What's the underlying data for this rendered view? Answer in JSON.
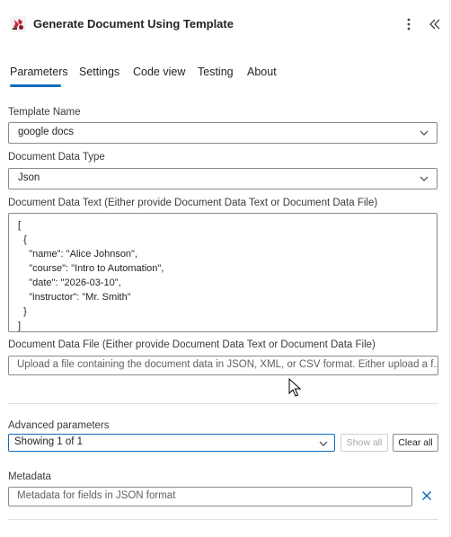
{
  "header": {
    "title": "Generate Document Using Template",
    "icons": {
      "app": "template-app-icon",
      "more": "more-vertical-icon",
      "collapse": "double-chevron-left-icon"
    }
  },
  "tabs": [
    {
      "label": "Parameters",
      "active": true
    },
    {
      "label": "Settings",
      "active": false
    },
    {
      "label": "Code view",
      "active": false
    },
    {
      "label": "Testing",
      "active": false
    },
    {
      "label": "About",
      "active": false
    }
  ],
  "form": {
    "template_name": {
      "label": "Template Name",
      "value": "google docs"
    },
    "document_data_type": {
      "label": "Document Data Type",
      "value": "Json"
    },
    "document_data_text": {
      "label": "Document Data Text (Either provide Document Data Text or Document Data File)",
      "value": "[\n  {\n    \"name\": \"Alice Johnson\",\n    \"course\": \"Intro to Automation\",\n    \"date\": \"2026-03-10\",\n    \"instructor\": \"Mr. Smith\"\n  }\n]"
    },
    "document_data_file": {
      "label": "Document Data File (Either provide Document Data Text or Document Data File)",
      "placeholder": "Upload a file containing the document data in JSON, XML, or CSV format. Either upload a f..."
    }
  },
  "advanced": {
    "label": "Advanced parameters",
    "selected": "Showing 1 of 1",
    "show_all": "Show all",
    "clear_all": "Clear all"
  },
  "metadata": {
    "label": "Metadata",
    "placeholder": "Metadata for fields in JSON format"
  },
  "colors": {
    "accent": "#0f6cbd",
    "text": "#242424",
    "border": "#8a8a8a"
  }
}
